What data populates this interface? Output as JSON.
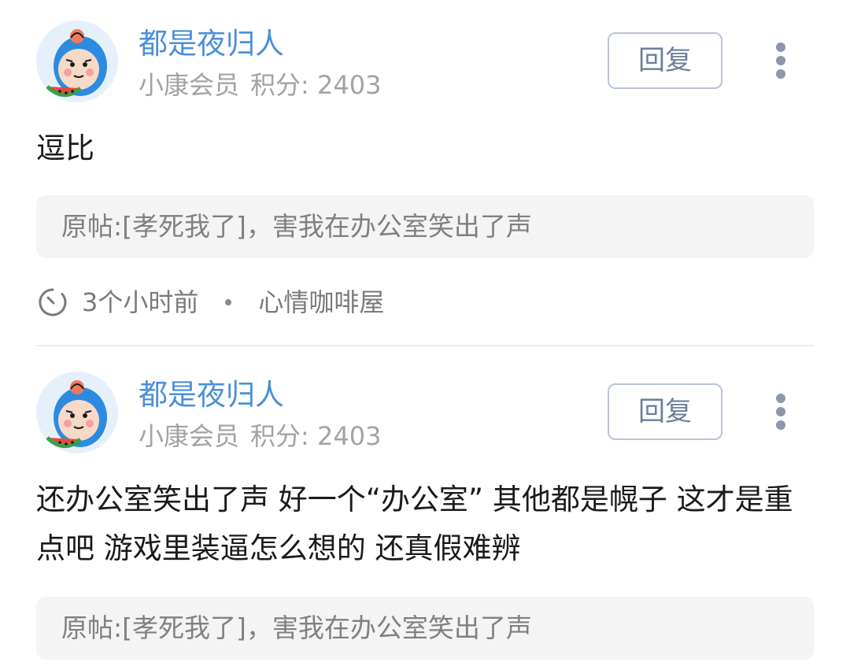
{
  "comments": [
    {
      "username": "都是夜归人",
      "member_level": "小康会员",
      "points_label": "积分:",
      "points_value": "2403",
      "reply_label": "回复",
      "more_icon": "vertical-dots-icon",
      "body": "逗比",
      "quote_prefix": "原帖:",
      "quote_text": "[孝死我了]，害我在办公室笑出了声",
      "time": "3个小时前",
      "forum": "心情咖啡屋"
    },
    {
      "username": "都是夜归人",
      "member_level": "小康会员",
      "points_label": "积分:",
      "points_value": "2403",
      "reply_label": "回复",
      "more_icon": "vertical-dots-icon",
      "body": "还办公室笑出了声 好一个“办公室” 其他都是幌子 这才是重点吧 游戏里装逼怎么想的 还真假难辨",
      "quote_prefix": "原帖:",
      "quote_text": "[孝死我了]，害我在办公室笑出了声"
    }
  ],
  "colors": {
    "username": "#4a8fd8",
    "meta": "#a3a3a3",
    "quote_bg": "#f4f4f4",
    "reply_border": "#b9c3d8"
  }
}
